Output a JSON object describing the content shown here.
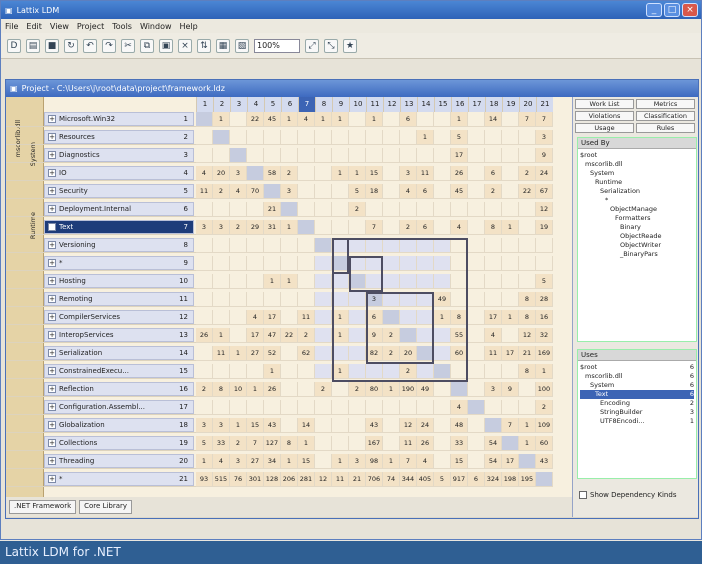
{
  "app": {
    "title": "Lattix LDM",
    "project_title": "Project - C:\\Users\\j\\root\\data\\project\\framework.ldz",
    "footer": "Lattix LDM for .NET"
  },
  "menu": [
    "File",
    "Edit",
    "View",
    "Project",
    "Tools",
    "Window",
    "Help"
  ],
  "toolbar": {
    "zoom": "100%"
  },
  "rows": [
    {
      "label": "Microsoft.Win32",
      "num": "1"
    },
    {
      "label": "Resources",
      "num": "2"
    },
    {
      "label": "Diagnostics",
      "num": "3"
    },
    {
      "label": "IO",
      "num": "4"
    },
    {
      "label": "Security",
      "num": "5"
    },
    {
      "label": "Deployment.Internal",
      "num": "6"
    },
    {
      "label": "Text",
      "num": "7"
    },
    {
      "label": "Versioning",
      "num": "8"
    },
    {
      "label": "*",
      "num": "9"
    },
    {
      "label": "Hosting",
      "num": "10"
    },
    {
      "label": "Remoting",
      "num": "11"
    },
    {
      "label": "CompilerServices",
      "num": "12"
    },
    {
      "label": "InteropServices",
      "num": "13"
    },
    {
      "label": "Serialization",
      "num": "14"
    },
    {
      "label": "ConstrainedExecu...",
      "num": "15"
    },
    {
      "label": "Reflection",
      "num": "16"
    },
    {
      "label": "Configuration.Assembl...",
      "num": "17"
    },
    {
      "label": "Globalization",
      "num": "18"
    },
    {
      "label": "Collections",
      "num": "19"
    },
    {
      "label": "Threading",
      "num": "20"
    },
    {
      "label": "*",
      "num": "21"
    }
  ],
  "sideLabels": {
    "outer": "mscorlib.dll",
    "inner": "System",
    "runtime": "Runtime"
  },
  "matrix_headers": [
    "1",
    "2",
    "3",
    "4",
    "5",
    "6",
    "7",
    "8",
    "9",
    "10",
    "11",
    "12",
    "13",
    "14",
    "15",
    "16",
    "17",
    "18",
    "19",
    "20",
    "21"
  ],
  "matrix_cells": [
    [
      "",
      "1",
      "",
      "22",
      "45",
      "1",
      "4",
      "1",
      "1",
      "",
      "1",
      "",
      "6",
      "",
      "",
      "1",
      "",
      "14",
      "",
      "7",
      "7"
    ],
    [
      "",
      "",
      "",
      "",
      "",
      "",
      "",
      "",
      "",
      "",
      "",
      "",
      "",
      "1",
      "",
      "5",
      "",
      "",
      "",
      "",
      "3"
    ],
    [
      "",
      "",
      "",
      "",
      "",
      "",
      "",
      "",
      "",
      "",
      "",
      "",
      "",
      "",
      "",
      "17",
      "",
      "",
      "",
      "",
      "9"
    ],
    [
      "4",
      "20",
      "3",
      "",
      "58",
      "2",
      "",
      "",
      "1",
      "1",
      "15",
      "",
      "3",
      "11",
      "",
      "26",
      "",
      "6",
      "",
      "2",
      "24"
    ],
    [
      "11",
      "2",
      "4",
      "70",
      "",
      "3",
      "",
      "",
      "",
      "5",
      "18",
      "",
      "4",
      "6",
      "",
      "45",
      "",
      "2",
      "",
      "22",
      "67"
    ],
    [
      "",
      "",
      "",
      "",
      "21",
      "",
      "",
      "",
      "",
      "2",
      "",
      "",
      "",
      "",
      "",
      "",
      "",
      "",
      "",
      "",
      "12"
    ],
    [
      "3",
      "3",
      "2",
      "29",
      "31",
      "1",
      "",
      "",
      "",
      "",
      "7",
      "",
      "2",
      "6",
      "",
      "4",
      "",
      "8",
      "1",
      "",
      "19"
    ],
    [
      "",
      "",
      "",
      "",
      "",
      "",
      "",
      "",
      "",
      "",
      "",
      "",
      "",
      "",
      "",
      "",
      "",
      "",
      "",
      "",
      ""
    ],
    [
      "",
      "",
      "",
      "",
      "",
      "",
      "",
      "",
      "",
      "",
      "",
      "",
      "",
      "",
      "",
      "",
      "",
      "",
      "",
      "",
      ""
    ],
    [
      "",
      "",
      "",
      "",
      "1",
      "1",
      "",
      "",
      "",
      "",
      "",
      "",
      "",
      "",
      "",
      "",
      "",
      "",
      "",
      "",
      "5"
    ],
    [
      "",
      "",
      "",
      "",
      "",
      "",
      "",
      "",
      "",
      "",
      "3",
      "",
      "",
      "",
      "49",
      "",
      "",
      "",
      "",
      "8",
      "28"
    ],
    [
      "",
      "",
      "",
      "4",
      "17",
      "",
      "11",
      "",
      "1",
      "",
      "6",
      "",
      "",
      "",
      "1",
      "8",
      "",
      "17",
      "1",
      "8",
      "16"
    ],
    [
      "26",
      "1",
      "",
      "17",
      "47",
      "22",
      "2",
      "",
      "1",
      "",
      "9",
      "2",
      "",
      "",
      "",
      "55",
      "",
      "4",
      "",
      "12",
      "32"
    ],
    [
      "",
      "11",
      "1",
      "27",
      "52",
      "",
      "62",
      "",
      "",
      "",
      "82",
      "2",
      "20",
      "",
      "",
      "60",
      "",
      "11",
      "17",
      "21",
      "169"
    ],
    [
      "",
      "",
      "",
      "",
      "1",
      "",
      "",
      "",
      "1",
      "",
      "",
      "",
      "2",
      "",
      "",
      "",
      "",
      "",
      "",
      "8",
      "1"
    ],
    [
      "2",
      "8",
      "10",
      "1",
      "26",
      "",
      "",
      "2",
      "",
      "2",
      "80",
      "1",
      "190",
      "49",
      "",
      "",
      "",
      "3",
      "9",
      "",
      "100"
    ],
    [
      "",
      "",
      "",
      "",
      "",
      "",
      "",
      "",
      "",
      "",
      "",
      "",
      "",
      "",
      "",
      "4",
      "",
      "",
      "",
      "",
      "2"
    ],
    [
      "3",
      "3",
      "1",
      "15",
      "43",
      "",
      "14",
      "",
      "",
      "",
      "43",
      "",
      "12",
      "24",
      "",
      "48",
      "",
      "",
      "7",
      "1",
      "109"
    ],
    [
      "5",
      "33",
      "2",
      "7",
      "127",
      "8",
      "1",
      "",
      "",
      "",
      "167",
      "",
      "11",
      "26",
      "",
      "33",
      "",
      "54",
      "",
      "1",
      "60"
    ],
    [
      "1",
      "4",
      "3",
      "27",
      "34",
      "1",
      "15",
      "",
      "1",
      "3",
      "98",
      "1",
      "7",
      "4",
      "",
      "15",
      "",
      "54",
      "17",
      "",
      "43"
    ],
    [
      "93",
      "515",
      "76",
      "301",
      "128",
      "206",
      "281",
      "12",
      "11",
      "21",
      "706",
      "74",
      "344",
      "405",
      "5",
      "917",
      "6",
      "324",
      "198",
      "195",
      ""
    ]
  ],
  "panel": {
    "tabs": [
      "Work List",
      "Metrics",
      "Violations",
      "Classification",
      "Usage",
      "Rules"
    ],
    "usedby_title": "Used By",
    "usedby_items": [
      "$root",
      "mscorlib.dll",
      "System",
      "Runtime",
      "Serialization",
      "*",
      "ObjectManage",
      "Formatters",
      "Binary",
      "ObjectReade",
      "ObjectWriter",
      "_BinaryPars"
    ],
    "uses_title": "Uses",
    "uses_items": [
      [
        "$root",
        "6"
      ],
      [
        "mscorlib.dll",
        "6"
      ],
      [
        "System",
        "6"
      ],
      [
        "Text",
        "6"
      ],
      [
        "Encoding",
        "2"
      ],
      [
        "StringBuilder",
        "3"
      ],
      [
        "UTF8Encodi...",
        "1"
      ]
    ],
    "show_kinds": "Show Dependency Kinds"
  },
  "bottom_tabs": [
    ".NET Framework",
    "Core Library"
  ]
}
